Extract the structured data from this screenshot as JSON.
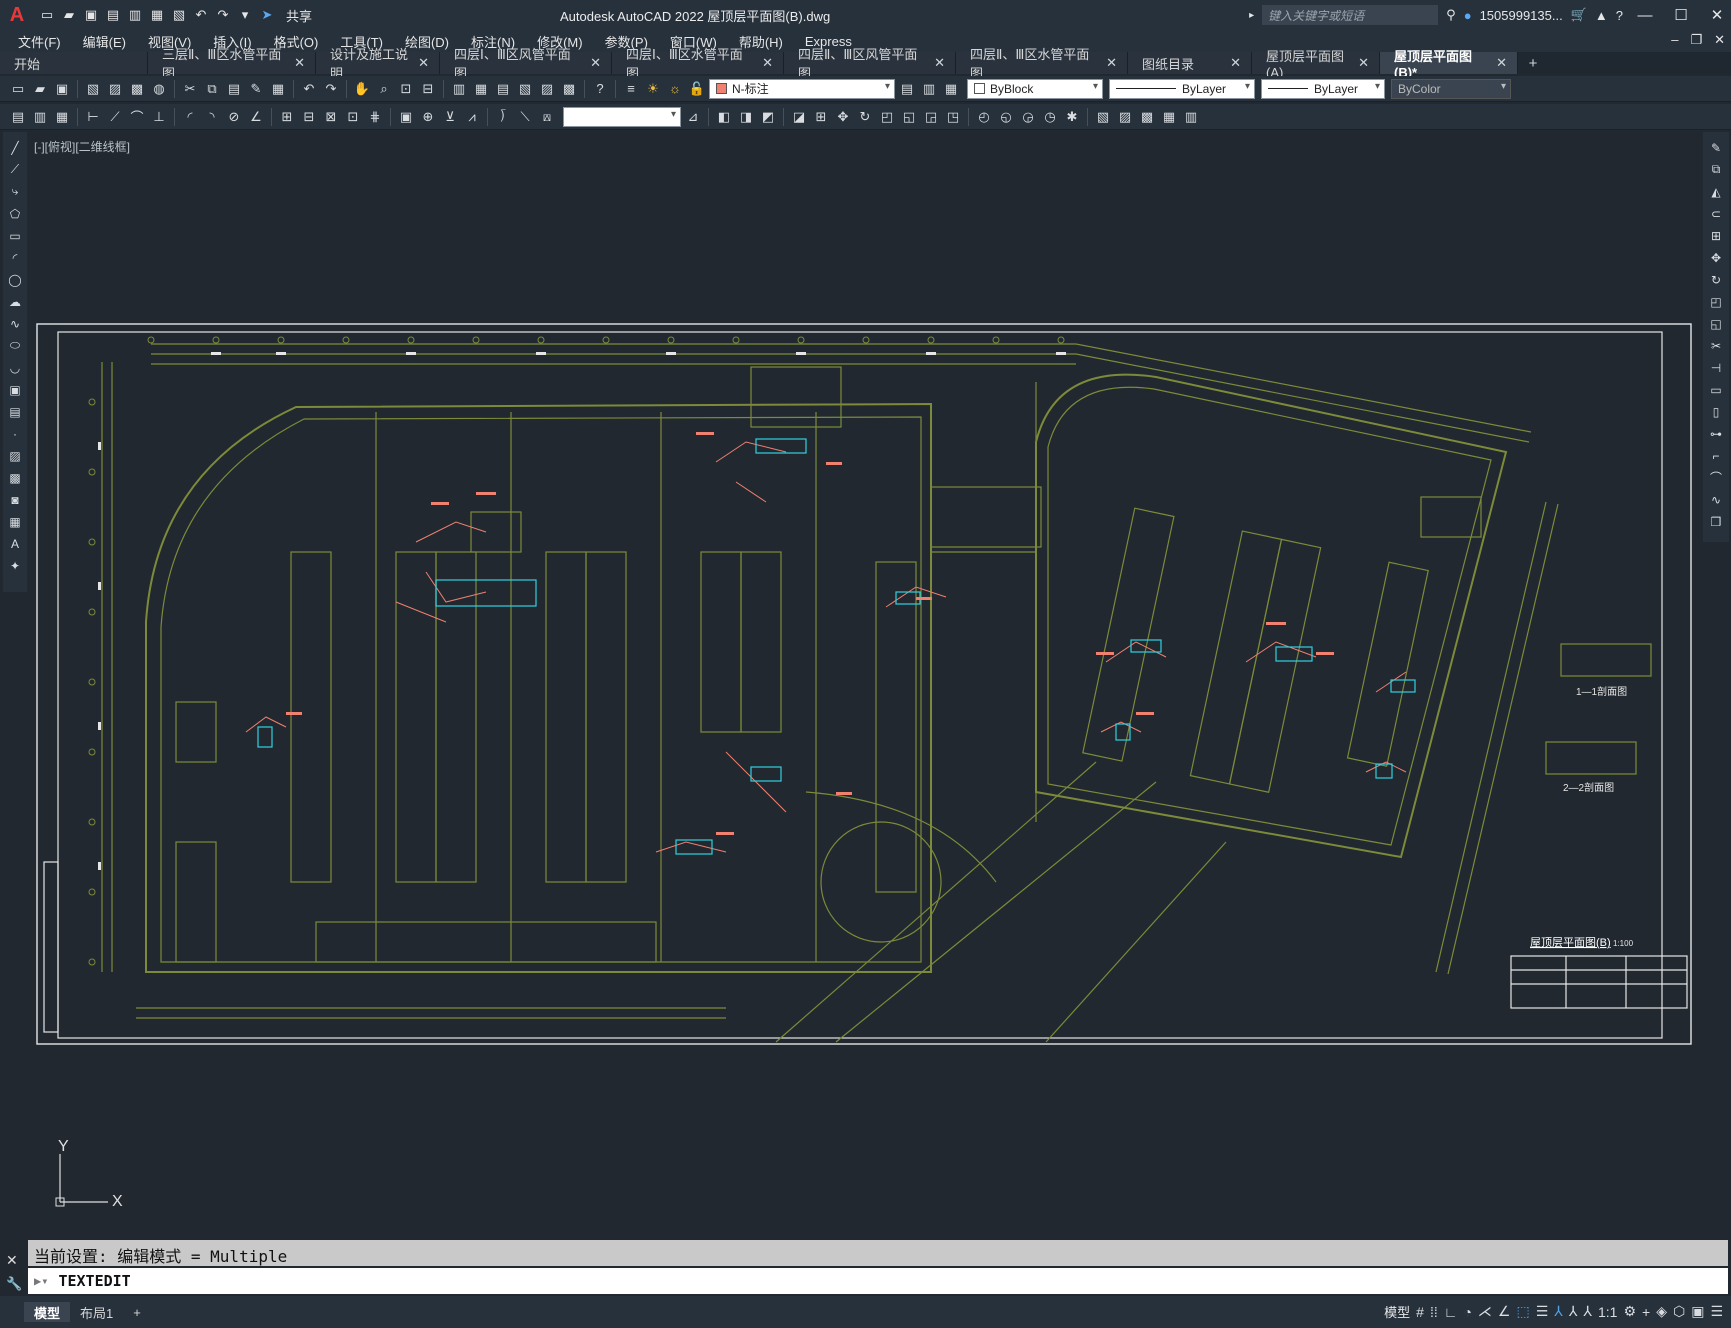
{
  "app": {
    "title": "Autodesk AutoCAD 2022    屋顶层平面图(B).dwg",
    "share_label": "共享",
    "search_placeholder": "键入关键字或短语",
    "user": "1505999135...",
    "logo_letter": "A"
  },
  "menu": [
    "文件(F)",
    "编辑(E)",
    "视图(V)",
    "插入(I)",
    "格式(O)",
    "工具(T)",
    "绘图(D)",
    "标注(N)",
    "修改(M)",
    "参数(P)",
    "窗口(W)",
    "帮助(H)",
    "Express"
  ],
  "tabs": [
    {
      "label": "开始",
      "closable": false,
      "active": false
    },
    {
      "label": "三层Ⅱ、Ⅲ区水管平面图",
      "closable": true,
      "active": false
    },
    {
      "label": "设计及施工说明",
      "closable": true,
      "active": false
    },
    {
      "label": "四层Ⅰ、Ⅲ区风管平面图",
      "closable": true,
      "active": false
    },
    {
      "label": "四层Ⅰ、Ⅲ区水管平面图",
      "closable": true,
      "active": false
    },
    {
      "label": "四层Ⅱ、Ⅲ区风管平面图",
      "closable": true,
      "active": false
    },
    {
      "label": "四层Ⅱ、Ⅲ区水管平面图",
      "closable": true,
      "active": false
    },
    {
      "label": "图纸目录",
      "closable": true,
      "active": false
    },
    {
      "label": "屋顶层平面图(A)",
      "closable": true,
      "active": false
    },
    {
      "label": "屋顶层平面图(B)*",
      "closable": true,
      "active": true
    }
  ],
  "toolbar": {
    "layer": "N-标注",
    "color": "ByBlock",
    "linetype": "ByLayer",
    "lineweight": "ByLayer",
    "plotstyle": "ByColor"
  },
  "viewport": {
    "label": "[-][俯视][二维线框]"
  },
  "drawing": {
    "section1": "1—1剖面图",
    "section2": "2—2剖面图",
    "plan_title": "屋顶层平面图(B)",
    "plan_scale": "1:100"
  },
  "ucs": {
    "x": "X",
    "y": "Y"
  },
  "command": {
    "history": "当前设置: 编辑模式 = Multiple",
    "input": "TEXTEDIT"
  },
  "layout_tabs": [
    "模型",
    "布局1"
  ],
  "status": {
    "model": "模型",
    "scale": "1:1"
  },
  "colors": {
    "drawing_lines": "#7c8a3a",
    "annotations": "#f08070",
    "pipes": "#2fd0e0",
    "background": "#212830"
  }
}
